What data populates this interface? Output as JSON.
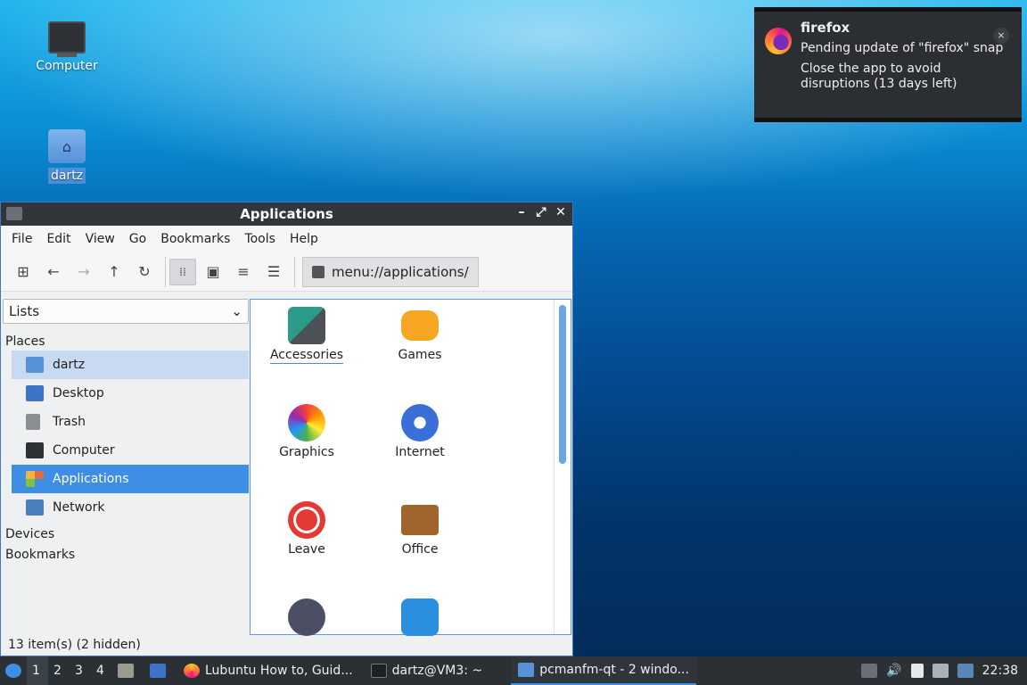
{
  "desktop": {
    "icons": [
      {
        "label": "Computer"
      },
      {
        "label": "dartz"
      }
    ]
  },
  "notification": {
    "app": "firefox",
    "close": "×",
    "line1": "Pending update of \"firefox\" snap",
    "line2": "Close the app to avoid disruptions (13 days left)"
  },
  "window": {
    "title": "Applications",
    "controls": {
      "minimize": "–",
      "maximize": "⤢",
      "close": "✕"
    },
    "menu": [
      "File",
      "Edit",
      "View",
      "Go",
      "Bookmarks",
      "Tools",
      "Help"
    ],
    "toolbar": {
      "new_tab": "⊞",
      "back": "←",
      "forward": "→",
      "up": "↑",
      "reload": "↻",
      "icon_view": "⁞⁞",
      "thumb_view": "▣",
      "compact_view": "≡",
      "list_view": "☰"
    },
    "address": "menu://applications/",
    "sidebar": {
      "mode": "Lists",
      "places_label": "Places",
      "places": [
        {
          "label": "dartz",
          "color": "#5592d8"
        },
        {
          "label": "Desktop",
          "color": "#3d73c9"
        },
        {
          "label": "Trash",
          "color": "#8a8d91"
        },
        {
          "label": "Computer",
          "color": "#2e3237"
        },
        {
          "label": "Applications",
          "color": "#e06c3c"
        },
        {
          "label": "Network",
          "color": "#4a7fc0"
        }
      ],
      "devices_label": "Devices",
      "bookmarks_label": "Bookmarks"
    },
    "items": [
      {
        "label": "Accessories"
      },
      {
        "label": "Games"
      },
      {
        "label": "Graphics"
      },
      {
        "label": "Internet"
      },
      {
        "label": "Leave"
      },
      {
        "label": "Office"
      }
    ],
    "status": "13 item(s) (2 hidden)"
  },
  "taskbar": {
    "workspaces": [
      "1",
      "2",
      "3",
      "4"
    ],
    "tasks": [
      {
        "label": "Lubuntu How to, Guid..."
      },
      {
        "label": "dartz@VM3: ~"
      },
      {
        "label": "pcmanfm-qt - 2 windo..."
      }
    ],
    "clock": "22:38"
  }
}
